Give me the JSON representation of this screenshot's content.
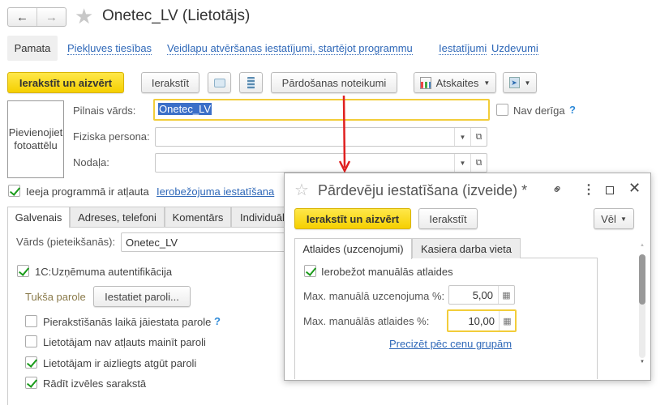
{
  "window": {
    "title": "Onetec_LV (Lietotājs)"
  },
  "nav_tabs": [
    {
      "label": "Pamata"
    },
    {
      "label": "Piekļuves tiesības"
    },
    {
      "label": "Veidlapu atvēršanas iestatījumi, startējot programmu"
    },
    {
      "label": "Iestatījumi"
    },
    {
      "label": "Uzdevumi"
    }
  ],
  "toolbar": {
    "save_close": "Ierakstīt un aizvērt",
    "save": "Ierakstīt",
    "sales_rules": "Pārdošanas noteikumi",
    "reports": "Atskaites"
  },
  "form": {
    "photo": "Pievienojiet fotoattēlu",
    "full_name_label": "Pilnais vārds:",
    "full_name_value": "Onetec_LV",
    "person_label": "Fiziska persona:",
    "person_value": "",
    "department_label": "Nodaļa:",
    "department_value": "",
    "invalid_label": "Nav derīga",
    "invalid_checked": false,
    "help": "?",
    "login_allowed_label": "Ieeja programmā ir atļauta",
    "login_allowed_checked": true,
    "restriction_link": "Ierobežojuma iestatīšana"
  },
  "tabs": [
    {
      "label": "Galvenais",
      "active": true
    },
    {
      "label": "Adreses, telefoni"
    },
    {
      "label": "Komentārs"
    },
    {
      "label": "Individuāl"
    }
  ],
  "main": {
    "login_name_label": "Vārds (pieteikšanās):",
    "login_name_value": "Onetec_LV",
    "auth_label": "1C:Uzņēmuma autentifikācija",
    "auth_checked": true,
    "empty_password": "Tukša parole",
    "set_password": "Iestatiet paroli...",
    "options": [
      {
        "label": "Pierakstīšanās laikā jāiestata parole",
        "checked": false,
        "help": true
      },
      {
        "label": "Lietotājam nav atļauts mainīt paroli",
        "checked": false
      },
      {
        "label": "Lietotājam ir aizliegts atgūt paroli",
        "checked": true
      },
      {
        "label": "Rādīt izvēles sarakstā",
        "checked": true
      }
    ]
  },
  "dialog": {
    "title": "Pārdevēju iestatīšana (izveide) *",
    "save_close": "Ierakstīt un aizvērt",
    "save": "Ierakstīt",
    "more": "Vēl",
    "tabs": [
      {
        "label": "Atlaides (uzcenojumi)",
        "active": true
      },
      {
        "label": "Kasiera darba vieta"
      }
    ],
    "limit_label": "Ierobežot manuālās atlaides",
    "limit_checked": true,
    "markup_label": "Max. manuālā uzcenojuma %:",
    "markup_value": "5,00",
    "discount_label": "Max. manuālās atlaides %:",
    "discount_value": "10,00",
    "price_groups_link": "Precizēt pēc cenu grupām"
  },
  "colors": {
    "accent_yellow": "#f5cf00",
    "link": "#2f68b8",
    "arrow": "#e02020",
    "check": "#1a9b1a"
  }
}
